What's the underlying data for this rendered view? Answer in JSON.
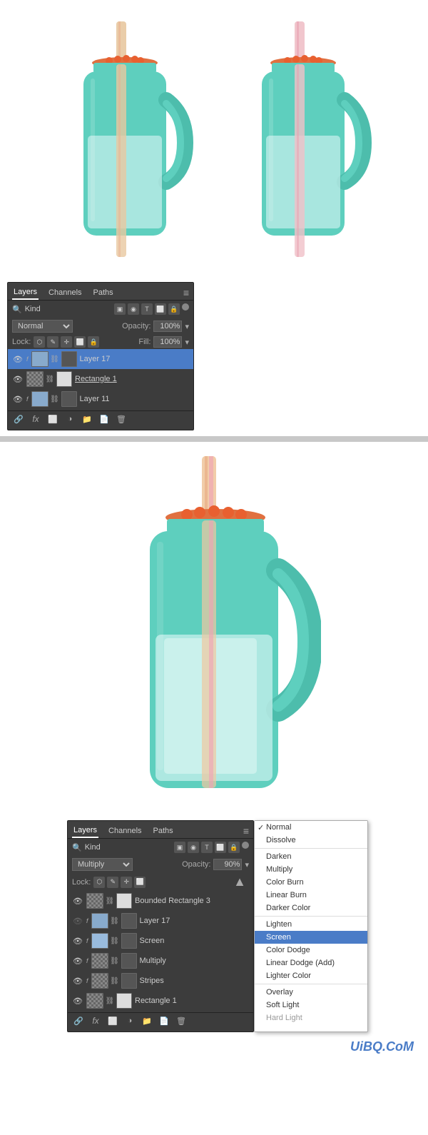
{
  "top_section": {
    "jar_left": {
      "straw_color": "#e8b4a0",
      "jar_color": "#5ecfbe",
      "lid_color": "#e86030",
      "liquid_color": "#c8f0ec"
    },
    "jar_right": {
      "straw_color": "#e8a0b4",
      "jar_color": "#5ecfbe",
      "lid_color": "#e86030",
      "liquid_color": "#c8f0ec"
    }
  },
  "top_layers_panel": {
    "tabs": [
      "Layers",
      "Channels",
      "Paths"
    ],
    "active_tab": "Layers",
    "search_kind": "Kind",
    "blend_mode": "Normal",
    "opacity_label": "Opacity:",
    "opacity_value": "100%",
    "lock_label": "Lock:",
    "fill_label": "Fill:",
    "fill_value": "100%",
    "layers": [
      {
        "name": "Layer 17",
        "visible": true,
        "selected": true,
        "has_fx": true
      },
      {
        "name": "Rectangle 1",
        "visible": true,
        "selected": false,
        "has_fx": false,
        "underline": true
      },
      {
        "name": "Layer 11",
        "visible": true,
        "selected": false,
        "has_fx": true
      }
    ],
    "menu_icon": "≡"
  },
  "bottom_layers_panel": {
    "tabs": [
      "Layers",
      "Channels",
      "Paths"
    ],
    "active_tab": "Layers",
    "search_kind": "Kind",
    "blend_mode": "Multiply",
    "opacity_label": "Opacity:",
    "opacity_value": "90%",
    "lock_label": "Lock:",
    "layers": [
      {
        "name": "Bounded Rectangle 3",
        "visible": true,
        "selected": false,
        "has_fx": false
      },
      {
        "name": "Layer 17",
        "visible": false,
        "selected": false,
        "has_fx": true
      },
      {
        "name": "Screen",
        "visible": true,
        "selected": false,
        "has_fx": false
      },
      {
        "name": "Multiply",
        "visible": true,
        "selected": false,
        "has_fx": true
      },
      {
        "name": "Stripes",
        "visible": true,
        "selected": false,
        "has_fx": false
      },
      {
        "name": "Rectangle 1",
        "visible": true,
        "selected": false,
        "has_fx": false
      }
    ],
    "menu_icon": "≡"
  },
  "blend_dropdown": {
    "items": [
      {
        "label": "Normal",
        "checked": true,
        "selected": false,
        "disabled": false
      },
      {
        "label": "Dissolve",
        "checked": false,
        "selected": false,
        "disabled": false
      },
      {
        "label": "Darken",
        "checked": false,
        "selected": false,
        "disabled": false,
        "divider_before": true
      },
      {
        "label": "Multiply",
        "checked": false,
        "selected": false,
        "disabled": false
      },
      {
        "label": "Color Burn",
        "checked": false,
        "selected": false,
        "disabled": false
      },
      {
        "label": "Linear Burn",
        "checked": false,
        "selected": false,
        "disabled": false
      },
      {
        "label": "Darker Color",
        "checked": false,
        "selected": false,
        "disabled": false
      },
      {
        "label": "Lighten",
        "checked": false,
        "selected": false,
        "disabled": false,
        "divider_before": true
      },
      {
        "label": "Screen",
        "checked": false,
        "selected": true,
        "disabled": false
      },
      {
        "label": "Color Dodge",
        "checked": false,
        "selected": false,
        "disabled": false
      },
      {
        "label": "Linear Dodge (Add)",
        "checked": false,
        "selected": false,
        "disabled": false
      },
      {
        "label": "Lighter Color",
        "checked": false,
        "selected": false,
        "disabled": false
      },
      {
        "label": "Overlay",
        "checked": false,
        "selected": false,
        "disabled": false,
        "divider_before": true
      },
      {
        "label": "Soft Light",
        "checked": false,
        "selected": false,
        "disabled": false
      },
      {
        "label": "Hard Light",
        "checked": false,
        "selected": false,
        "disabled": true
      }
    ]
  },
  "watermark": {
    "text": "UiBQ.CoM",
    "color": "#4a7cc7"
  },
  "normal_dissolve_label": "Normal Dissolve"
}
